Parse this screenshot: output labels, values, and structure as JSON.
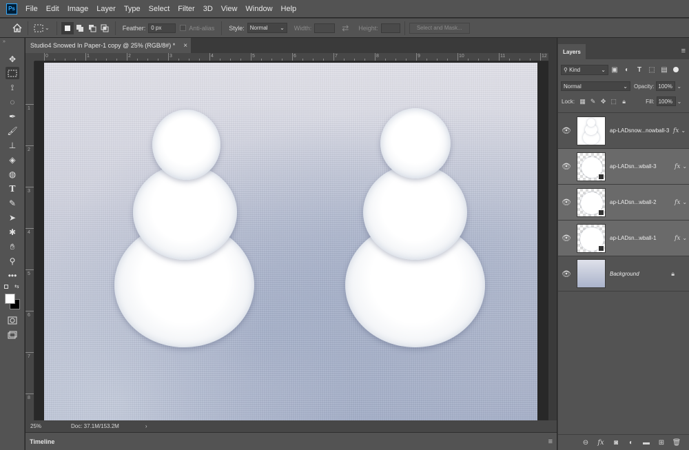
{
  "app": {
    "logo": "Ps"
  },
  "menu": [
    "File",
    "Edit",
    "Image",
    "Layer",
    "Type",
    "Select",
    "Filter",
    "3D",
    "View",
    "Window",
    "Help"
  ],
  "options": {
    "feather_label": "Feather:",
    "feather_value": "0 px",
    "antialias_label": "Anti-alias",
    "style_label": "Style:",
    "style_value": "Normal",
    "width_label": "Width:",
    "height_label": "Height:",
    "select_mask_label": "Select and Mask..."
  },
  "document": {
    "tab_title": "Studio4 Snowed In Paper-1 copy @ 25% (RGB/8#) *",
    "zoom": "25%",
    "doc_size": "Doc: 37.1M/153.2M",
    "ruler_top_labels": [
      "0",
      "1",
      "2",
      "3",
      "4",
      "5",
      "6",
      "7",
      "8",
      "9",
      "10",
      "11",
      "12"
    ],
    "ruler_left_labels": [
      "1",
      "2",
      "3",
      "4",
      "5",
      "6",
      "7",
      "8"
    ]
  },
  "timeline": {
    "tab_label": "Timeline"
  },
  "layers_panel": {
    "tab_label": "Layers",
    "kind_label": "Kind",
    "blend_mode": "Normal",
    "opacity_label": "Opacity:",
    "opacity_value": "100%",
    "lock_label": "Lock:",
    "fill_label": "Fill:",
    "fill_value": "100%",
    "layers": [
      {
        "name": "ap-LADsnow...nowball-3",
        "fx": "fx",
        "thumb": "snowman"
      },
      {
        "name": "ap-LADsn...wball-3",
        "fx": "fx",
        "thumb": "ball"
      },
      {
        "name": "ap-LADsn...wball-2",
        "fx": "fx",
        "thumb": "ball"
      },
      {
        "name": "ap-LADsn...wball-1",
        "fx": "fx",
        "thumb": "ball"
      },
      {
        "name": "Background",
        "fx": "",
        "thumb": "background"
      }
    ]
  },
  "colors": {
    "ui_dark": "#535353",
    "ui_darker": "#3a3a3a",
    "selected_layer": "#6a6a6a",
    "ps_blue": "#31a8ff"
  }
}
